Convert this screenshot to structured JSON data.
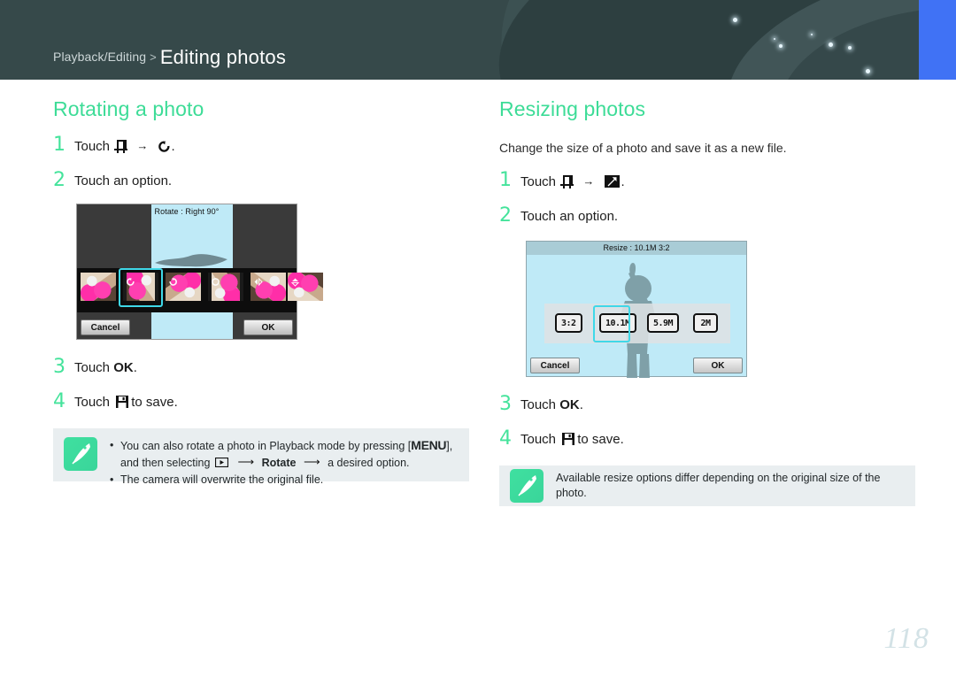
{
  "header": {
    "breadcrumb_parent": "Playback/Editing",
    "breadcrumb_separator": ">",
    "breadcrumb_title": "Editing photos",
    "accent_blue": "#4072f5",
    "background": "#36494a"
  },
  "left_column": {
    "heading": "Rotating a photo",
    "steps": [
      {
        "num": "1",
        "text_before": "Touch",
        "text_after": "."
      },
      {
        "num": "2",
        "text": "Touch an option."
      },
      {
        "num": "3",
        "text_before": "Touch",
        "emphasis": "OK",
        "text_after": "."
      },
      {
        "num": "4",
        "text_before": "Touch",
        "text_after": "to save."
      }
    ],
    "screen": {
      "title": "Rotate : Right 90°",
      "cancel_label": "Cancel",
      "ok_label": "OK"
    },
    "note": {
      "bullet": "•",
      "line1_a": "You can also rotate a photo in Playback mode by pressing [",
      "line1_menu": "MENU",
      "line1_b": "], and then selecting",
      "line1_c": "",
      "line1_rotate": "Rotate",
      "line1_d": "a desired option.",
      "line2": "The camera will overwrite the original file."
    }
  },
  "right_column": {
    "heading": "Resizing photos",
    "intro": "Change the size of a photo and save it as a new file.",
    "steps": [
      {
        "num": "1",
        "text_before": "Touch",
        "text_after": "."
      },
      {
        "num": "2",
        "text": "Touch an option."
      },
      {
        "num": "3",
        "text_before": "Touch",
        "emphasis": "OK",
        "text_after": "."
      },
      {
        "num": "4",
        "text_before": "Touch",
        "text_after": "to save."
      }
    ],
    "screen": {
      "title": "Resize : 10.1M 3:2",
      "options": [
        "3:2",
        "10.1M",
        "5.9M",
        "2M"
      ],
      "selected_option": "10.1M",
      "cancel_label": "Cancel",
      "ok_label": "OK"
    },
    "note": {
      "text": "Available resize options differ depending on the original size of the photo."
    }
  },
  "footer": {
    "page_number": "118"
  },
  "colors": {
    "heading_green": "#3ddc97",
    "note_bg": "#e9eef0",
    "selection_cyan": "#3fd8e8",
    "page_number": "#d3e2e6"
  }
}
